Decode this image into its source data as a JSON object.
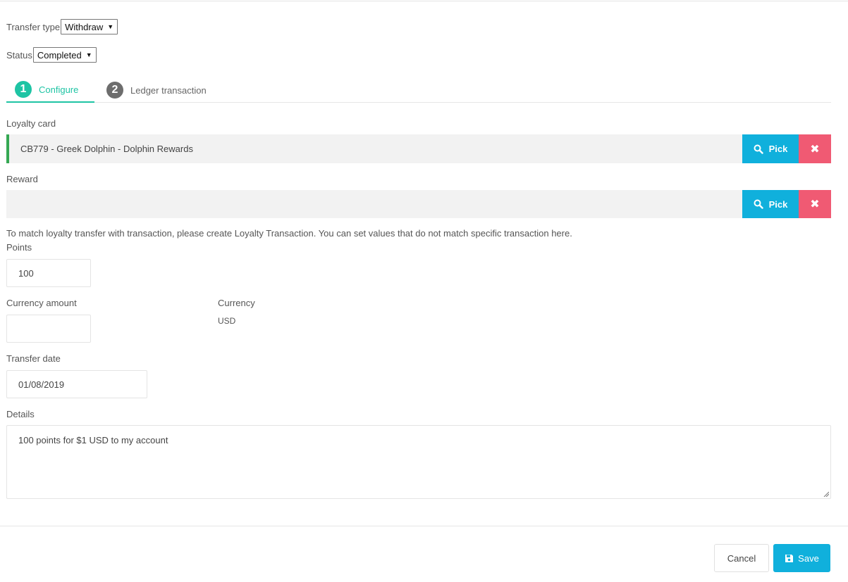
{
  "transfer_type": {
    "label": "Transfer type",
    "value": "Withdraw"
  },
  "status": {
    "label": "Status",
    "value": "Completed"
  },
  "tabs": [
    {
      "number": "1",
      "label": "Configure",
      "active": true
    },
    {
      "number": "2",
      "label": "Ledger transaction",
      "active": false
    }
  ],
  "loyalty_card": {
    "label": "Loyalty card",
    "value": "CB779 - Greek Dolphin - Dolphin Rewards",
    "pick_label": "Pick",
    "clear_label": "✖"
  },
  "reward": {
    "label": "Reward",
    "value": "",
    "pick_label": "Pick",
    "clear_label": "✖"
  },
  "note": "To match loyalty transfer with transaction, please create Loyalty Transaction. You can set values that do not match specific transaction here.",
  "points": {
    "label": "Points",
    "value": "100"
  },
  "currency_amount": {
    "label": "Currency amount",
    "value": ""
  },
  "currency": {
    "label": "Currency",
    "value": "USD"
  },
  "transfer_date": {
    "label": "Transfer date",
    "value": "01/08/2019"
  },
  "details": {
    "label": "Details",
    "value": "100 points for $1 USD to my account"
  },
  "footer": {
    "cancel_label": "Cancel",
    "save_label": "Save"
  },
  "colors": {
    "accent_teal": "#1ec4a4",
    "primary_blue": "#10b0dc",
    "danger_pink": "#f05a73",
    "valid_green": "#35a853"
  },
  "icons": {
    "pick": "search-icon",
    "clear": "close-icon",
    "save": "floppy-disk-icon",
    "select": "caret-down-icon"
  }
}
